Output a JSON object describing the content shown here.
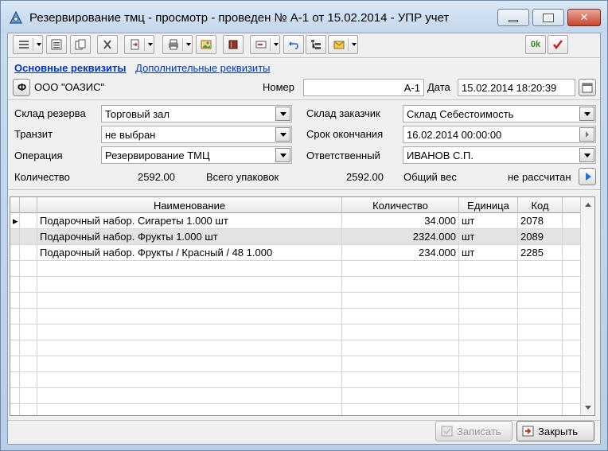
{
  "window": {
    "title": "Резервирование тмц - просмотр - проведен № А-1 от 15.02.2014 - УПР учет"
  },
  "toolbar": {
    "ok_label": "0k",
    "icons": [
      "menu-icon",
      "list-icon",
      "copy-icon",
      "cut-icon",
      "import-icon",
      "print-icon",
      "picture-icon",
      "book-icon",
      "card-icon",
      "undo-icon",
      "structure-icon",
      "envelope-icon",
      "ok-icon",
      "check-icon"
    ]
  },
  "tabs": [
    "Основные реквизиты",
    "Дополнительные реквизиты"
  ],
  "header": {
    "org_button": "Ф",
    "org_name": "ООО \"ОАЗИС\"",
    "number_label": "Номер",
    "number_value": "А-1",
    "date_label": "Дата",
    "date_value": "15.02.2014 18:20:39"
  },
  "form": {
    "sklad_rezerva_label": "Склад резерва",
    "sklad_rezerva_value": "Торговый зал",
    "tranzit_label": "Транзит",
    "tranzit_value": "не выбран",
    "operacia_label": "Операция",
    "operacia_value": "Резервирование ТМЦ",
    "sklad_zakazchik_label": "Склад заказчик",
    "sklad_zakazchik_value": "Склад Себестоимость",
    "srok_label": "Срок окончания",
    "srok_value": "16.02.2014 00:00:00",
    "otvetstvenny_label": "Ответственный",
    "otvetstvenny_value": "ИВАНОВ С.П."
  },
  "summary": {
    "kolichestvo_label": "Количество",
    "kolichestvo_value": "2592.00",
    "upakovok_label": "Всего упаковок",
    "upakovok_value": "2592.00",
    "ves_label": "Общий вес",
    "ves_value": "не рассчитан"
  },
  "table": {
    "columns": [
      "Наименование",
      "Количество",
      "Единица",
      "Код"
    ],
    "rows": [
      {
        "name": "Подарочный набор. Сигареты 1.000 шт",
        "qty": "34.000",
        "unit": "шт",
        "code": "2078"
      },
      {
        "name": "Подарочный набор. Фрукты 1.000 шт",
        "qty": "2324.000",
        "unit": "шт",
        "code": "2089"
      },
      {
        "name": "Подарочный набор. Фрукты  / Красный / 48 1.000",
        "qty": "234.000",
        "unit": "шт",
        "code": "2285"
      }
    ]
  },
  "buttons": {
    "save": "Записать",
    "close": "Закрыть"
  },
  "colors": {
    "link": "#0033cc",
    "title_bg": "#c9dcef",
    "close_btn": "#c9462e",
    "ok_green": "#2a8a1a",
    "check_red": "#cc1f1f"
  }
}
